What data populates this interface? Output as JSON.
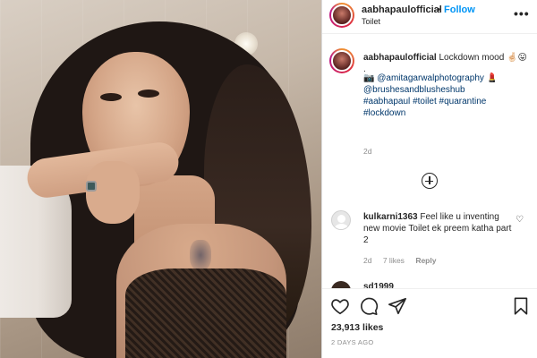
{
  "post": {
    "username": "aabhapaulofficial",
    "follow_label": "Follow",
    "separator": "•",
    "location": "Toilet",
    "more_label": "•••"
  },
  "caption": {
    "username": "aabhapaulofficial",
    "text": "Lockdown mood 🤞🏻😛",
    "dot": ".",
    "photo_emoji": "📷",
    "photographer": "@amitagarwalphotography",
    "lipstick_emoji": "💄",
    "makeup": "@brushesandblusheshub",
    "hashtags": [
      "#aabhapaul",
      "#toilet",
      "#quarantine",
      "#lockdown"
    ],
    "time": "2d"
  },
  "comment": {
    "username": "kulkarni1363",
    "text": "Feel like u inventing new movie Toilet ek preem katha part 2",
    "time": "2d",
    "likes": "7 likes",
    "reply_label": "Reply",
    "heart": "♡"
  },
  "next_comment": {
    "username": "sd1999"
  },
  "actions": {
    "like_icon": "heart-icon",
    "comment_icon": "comment-icon",
    "share_icon": "share-icon",
    "save_icon": "bookmark-icon"
  },
  "likes": "23,913 likes",
  "posted": "2 DAYS AGO"
}
